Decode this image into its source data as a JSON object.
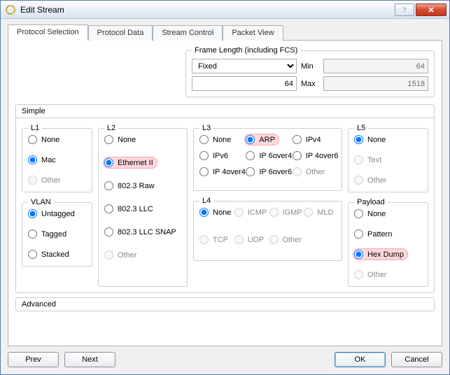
{
  "window": {
    "title": "Edit Stream"
  },
  "tabs": [
    "Protocol Selection",
    "Protocol Data",
    "Stream Control",
    "Packet View"
  ],
  "activeTab": 0,
  "frameLength": {
    "legend": "Frame Length (including FCS)",
    "mode": "Fixed",
    "fixedValue": "64",
    "minLabel": "Min",
    "maxLabel": "Max",
    "min": "64",
    "max": "1518"
  },
  "sections": {
    "simple": "Simple",
    "advanced": "Advanced"
  },
  "groups": {
    "l1": {
      "legend": "L1",
      "options": [
        {
          "label": "None",
          "checked": false,
          "disabled": false
        },
        {
          "label": "Mac",
          "checked": true,
          "disabled": false
        },
        {
          "label": "Other",
          "checked": false,
          "disabled": true
        }
      ]
    },
    "vlan": {
      "legend": "VLAN",
      "options": [
        {
          "label": "Untagged",
          "checked": true,
          "disabled": false
        },
        {
          "label": "Tagged",
          "checked": false,
          "disabled": false
        },
        {
          "label": "Stacked",
          "checked": false,
          "disabled": false
        }
      ]
    },
    "l2": {
      "legend": "L2",
      "options": [
        {
          "label": "None",
          "checked": false,
          "disabled": false
        },
        {
          "label": "Ethernet II",
          "checked": true,
          "disabled": false,
          "highlight": true
        },
        {
          "label": "802.3 Raw",
          "checked": false,
          "disabled": false
        },
        {
          "label": "802.3 LLC",
          "checked": false,
          "disabled": false
        },
        {
          "label": "802.3 LLC SNAP",
          "checked": false,
          "disabled": false
        },
        {
          "label": "Other",
          "checked": false,
          "disabled": true
        }
      ]
    },
    "l3": {
      "legend": "L3",
      "options": [
        {
          "label": "None",
          "checked": false,
          "disabled": false
        },
        {
          "label": "ARP",
          "checked": true,
          "disabled": false,
          "highlight": true
        },
        {
          "label": "IPv4",
          "checked": false,
          "disabled": false
        },
        {
          "label": "IPv6",
          "checked": false,
          "disabled": false
        },
        {
          "label": "IP 6over4",
          "checked": false,
          "disabled": false
        },
        {
          "label": "IP 4over6",
          "checked": false,
          "disabled": false
        },
        {
          "label": "IP 4over4",
          "checked": false,
          "disabled": false
        },
        {
          "label": "IP 6over6",
          "checked": false,
          "disabled": false
        },
        {
          "label": "Other",
          "checked": false,
          "disabled": true
        }
      ]
    },
    "l4": {
      "legend": "L4",
      "options": [
        {
          "label": "None",
          "checked": true,
          "disabled": false
        },
        {
          "label": "ICMP",
          "checked": false,
          "disabled": true
        },
        {
          "label": "IGMP",
          "checked": false,
          "disabled": true
        },
        {
          "label": "MLD",
          "checked": false,
          "disabled": true
        },
        {
          "label": "TCP",
          "checked": false,
          "disabled": true
        },
        {
          "label": "UDP",
          "checked": false,
          "disabled": true
        },
        {
          "label": "Other",
          "checked": false,
          "disabled": true
        }
      ]
    },
    "l5": {
      "legend": "L5",
      "options": [
        {
          "label": "None",
          "checked": true,
          "disabled": false
        },
        {
          "label": "Text",
          "checked": false,
          "disabled": true
        },
        {
          "label": "Other",
          "checked": false,
          "disabled": true
        }
      ]
    },
    "payload": {
      "legend": "Payload",
      "options": [
        {
          "label": "None",
          "checked": false,
          "disabled": false
        },
        {
          "label": "Pattern",
          "checked": false,
          "disabled": false
        },
        {
          "label": "Hex Dump",
          "checked": true,
          "disabled": false,
          "highlight": true
        },
        {
          "label": "Other",
          "checked": false,
          "disabled": true
        }
      ]
    }
  },
  "footer": {
    "prev": "Prev",
    "next": "Next",
    "ok": "OK",
    "cancel": "Cancel"
  }
}
